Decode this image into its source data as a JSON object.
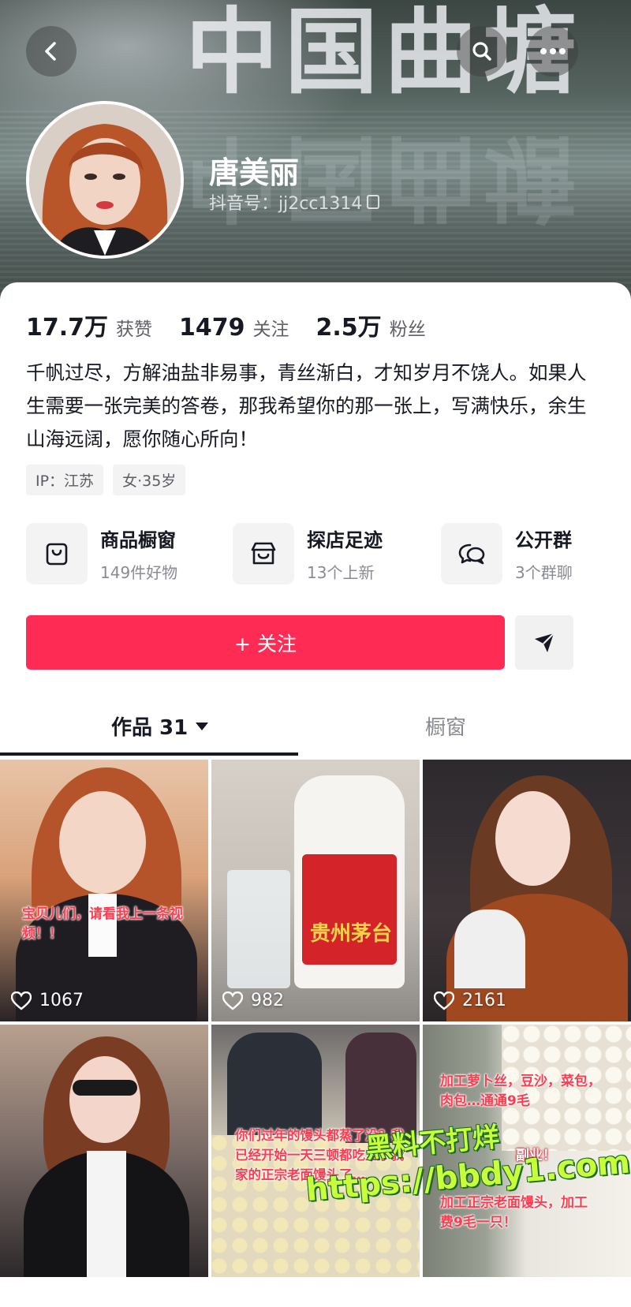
{
  "banner": {
    "sign_text": "中国曲塘"
  },
  "profile": {
    "name": "唐美丽",
    "douyin_id": "抖音号：jj2cc1314"
  },
  "stats": [
    {
      "value": "17.7万",
      "label": "获赞"
    },
    {
      "value": "1479",
      "label": "关注"
    },
    {
      "value": "2.5万",
      "label": "粉丝"
    }
  ],
  "bio": "千帆过尽，方解油盐非易事，青丝渐白，才知岁月不饶人。如果人生需要一张完美的答卷，那我希望你的那一张上，写满快乐，余生山海远阔，愿你随心所向！",
  "tags": [
    "IP：江苏",
    "女·35岁"
  ],
  "features": [
    {
      "title": "商品橱窗",
      "subtitle": "149件好物",
      "icon": "shopping-bag-icon"
    },
    {
      "title": "探店足迹",
      "subtitle": "13个上新",
      "icon": "store-icon"
    },
    {
      "title": "公开群",
      "subtitle": "3个群聊",
      "icon": "chat-bubbles-icon"
    }
  ],
  "actions": {
    "follow_label": "+ 关注",
    "share_icon": "send-icon"
  },
  "tabs": {
    "works_label": "作品 31",
    "shop_label": "橱窗"
  },
  "videos": [
    {
      "likes": "1067",
      "caption": "宝贝儿们，请看我上一条视频！！"
    },
    {
      "likes": "982",
      "caption": ""
    },
    {
      "likes": "2161",
      "caption": ""
    },
    {
      "likes": "",
      "caption": ""
    },
    {
      "likes": "",
      "caption": "你们过年的馒头都蒸了没？我已经开始一天三顿都吃上了我家的正宗老面馒头了…"
    },
    {
      "likes": "",
      "caption": "加工萝卜丝，豆沙，菜包，肉包…通通9毛",
      "caption2": "副业！",
      "caption3": "加工正宗老面馒头，加工费9毛一只！"
    }
  ],
  "bottle_label": "贵州茅台",
  "watermark": {
    "line1": "黑料不打烊",
    "line2": "https://bbdy1.com"
  },
  "colors": {
    "accent": "#fe2c55",
    "text_primary": "#161823",
    "text_secondary": "#8a8b91"
  }
}
